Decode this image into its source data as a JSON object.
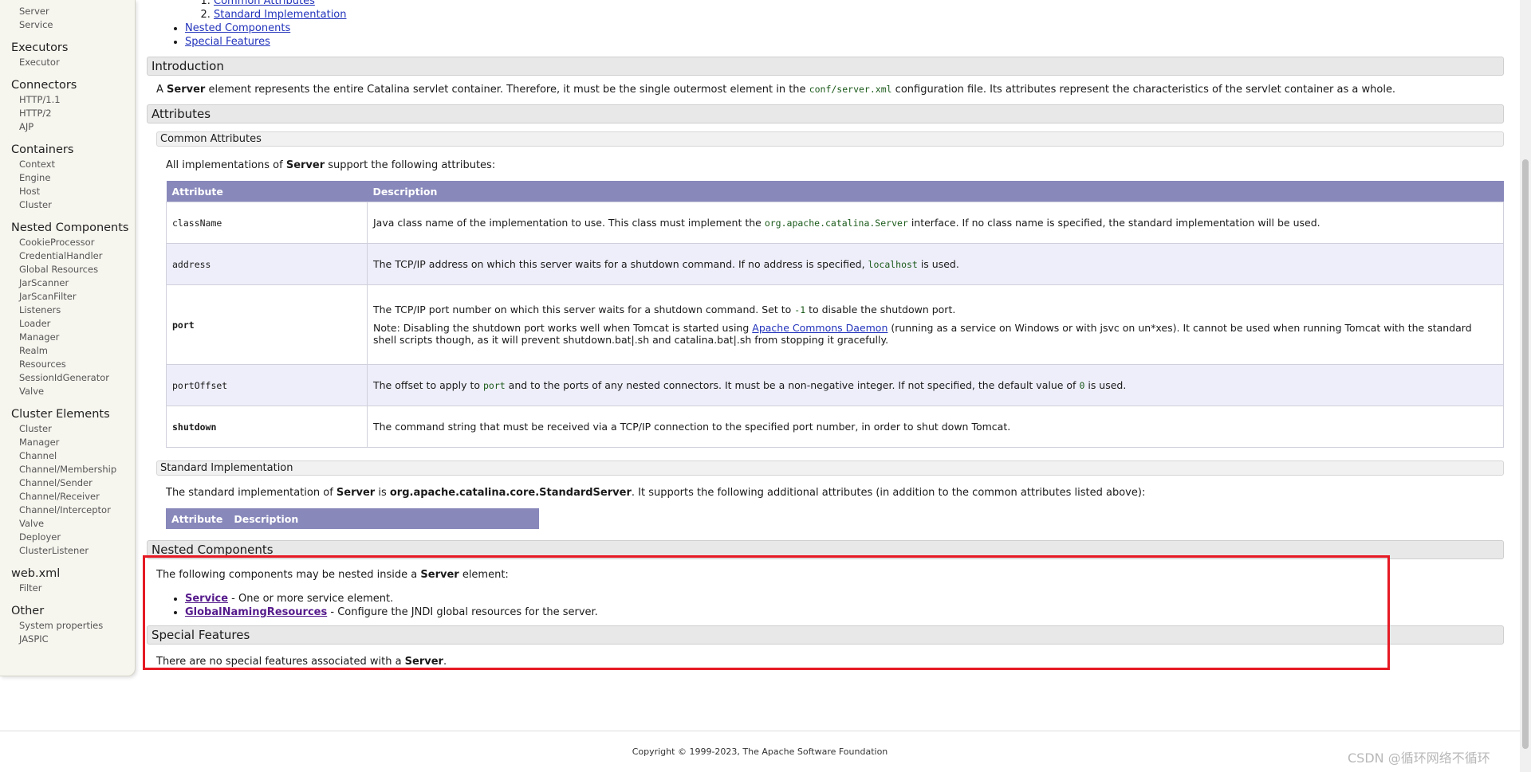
{
  "sidebar": {
    "top_items": [
      "Server",
      "Service"
    ],
    "groups": [
      {
        "title": "Executors",
        "items": [
          "Executor"
        ]
      },
      {
        "title": "Connectors",
        "items": [
          "HTTP/1.1",
          "HTTP/2",
          "AJP"
        ]
      },
      {
        "title": "Containers",
        "items": [
          "Context",
          "Engine",
          "Host",
          "Cluster"
        ]
      },
      {
        "title": "Nested Components",
        "items": [
          "CookieProcessor",
          "CredentialHandler",
          "Global Resources",
          "JarScanner",
          "JarScanFilter",
          "Listeners",
          "Loader",
          "Manager",
          "Realm",
          "Resources",
          "SessionIdGenerator",
          "Valve"
        ]
      },
      {
        "title": "Cluster Elements",
        "items": [
          "Cluster",
          "Manager",
          "Channel",
          "Channel/Membership",
          "Channel/Sender",
          "Channel/Receiver",
          "Channel/Interceptor",
          "Valve",
          "Deployer",
          "ClusterListener"
        ]
      },
      {
        "title": "web.xml",
        "items": [
          "Filter"
        ]
      },
      {
        "title": "Other",
        "items": [
          "System properties",
          "JASPIC"
        ]
      }
    ]
  },
  "toc": {
    "sub_items": [
      "Common Attributes",
      "Standard Implementation"
    ],
    "items": [
      "Nested Components",
      "Special Features"
    ]
  },
  "intro": {
    "heading": "Introduction",
    "text_1": "A ",
    "text_bold": "Server",
    "text_2": " element represents the entire Catalina servlet container. Therefore, it must be the single outermost element in the ",
    "text_code": "conf/server.xml",
    "text_3": " configuration file. Its attributes represent the characteristics of the servlet container as a whole."
  },
  "attributes": {
    "heading": "Attributes",
    "common": {
      "heading": "Common Attributes",
      "intro_1": "All implementations of ",
      "intro_bold": "Server",
      "intro_2": " support the following attributes:",
      "col_attr": "Attribute",
      "col_desc": "Description",
      "rows": [
        {
          "name": "className",
          "bold": false,
          "d1": "Java class name of the implementation to use. This class must implement the ",
          "dcode": "org.apache.catalina.Server",
          "d2": " interface. If no class name is specified, the standard implementation will be used."
        },
        {
          "name": "address",
          "bold": false,
          "d1": "The TCP/IP address on which this server waits for a shutdown command. If no address is specified, ",
          "dcode": "localhost",
          "d2": " is used."
        },
        {
          "name": "port",
          "bold": true,
          "d1": "The TCP/IP port number on which this server waits for a shutdown command. Set to ",
          "dcode": "-1",
          "d2": " to disable the shutdown port.",
          "note_1": "Note: Disabling the shutdown port works well when Tomcat is started using ",
          "note_link": "Apache Commons Daemon",
          "note_2": " (running as a service on Windows or with jsvc on un*xes). It cannot be used when running Tomcat with the standard shell scripts though, as it will prevent shutdown.bat|.sh and catalina.bat|.sh from stopping it gracefully."
        },
        {
          "name": "portOffset",
          "bold": false,
          "d1": "The offset to apply to ",
          "dcode": "port",
          "d2": " and to the ports of any nested connectors. It must be a non-negative integer. If not specified, the default value of ",
          "dcode2": "0",
          "d3": " is used."
        },
        {
          "name": "shutdown",
          "bold": true,
          "d1": "The command string that must be received via a TCP/IP connection to the specified port number, in order to shut down Tomcat.",
          "dcode": "",
          "d2": ""
        }
      ]
    },
    "standard": {
      "heading": "Standard Implementation",
      "t1": "The standard implementation of ",
      "tb1": "Server",
      "t2": " is ",
      "tb2": "org.apache.catalina.core.StandardServer",
      "t3": ". It supports the following additional attributes (in addition to the common attributes listed above):",
      "col_attr": "Attribute",
      "col_desc": "Description"
    }
  },
  "nested": {
    "heading": "Nested Components",
    "t1": "The following components may be nested inside a ",
    "tb": "Server",
    "t2": " element:",
    "items": [
      {
        "link": "Service",
        "desc": " - One or more service element."
      },
      {
        "link": "GlobalNamingResources",
        "desc": " - Configure the JNDI global resources for the server."
      }
    ]
  },
  "special": {
    "heading": "Special Features",
    "t1": "There are no special features associated with a ",
    "tb": "Server",
    "t2": "."
  },
  "footer": {
    "copyright": "Copyright © 1999-2023, The Apache Software Foundation",
    "watermark": "CSDN @循环网络不循环"
  },
  "colors": {
    "table_header": "#8888bb",
    "highlight_box": "#e51a24",
    "link": "#2233bb"
  }
}
